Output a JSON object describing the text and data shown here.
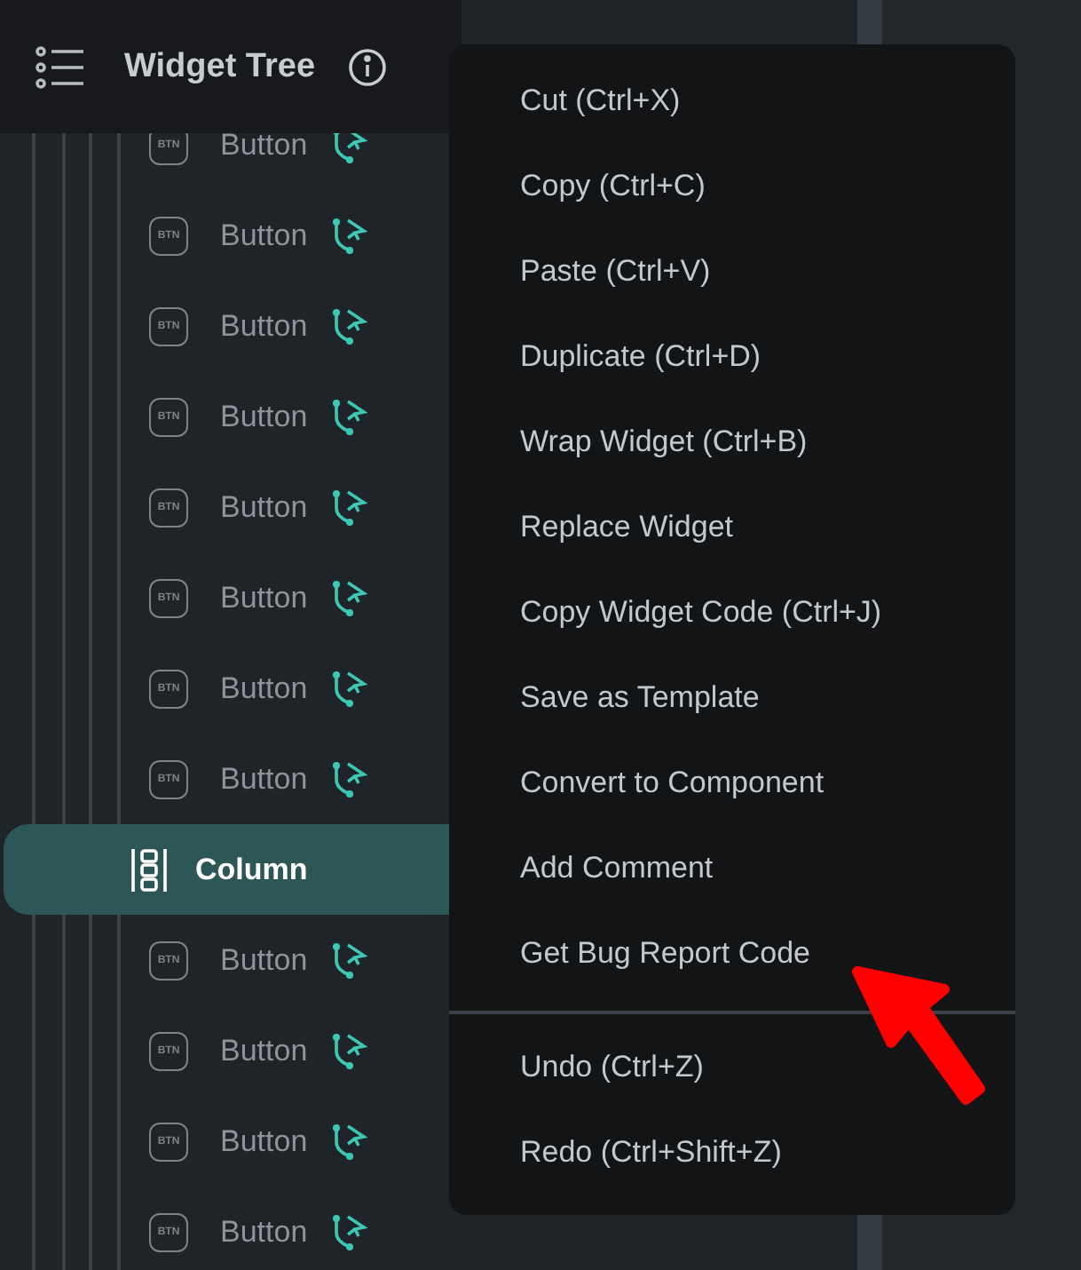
{
  "header": {
    "title": "Widget Tree"
  },
  "tree": {
    "rows": [
      {
        "kind": "button",
        "label": "Button",
        "icon_text": "BTN",
        "selected": false
      },
      {
        "kind": "button",
        "label": "Button",
        "icon_text": "BTN",
        "selected": false
      },
      {
        "kind": "button",
        "label": "Button",
        "icon_text": "BTN",
        "selected": false
      },
      {
        "kind": "button",
        "label": "Button",
        "icon_text": "BTN",
        "selected": false
      },
      {
        "kind": "button",
        "label": "Button",
        "icon_text": "BTN",
        "selected": false
      },
      {
        "kind": "button",
        "label": "Button",
        "icon_text": "BTN",
        "selected": false
      },
      {
        "kind": "button",
        "label": "Button",
        "icon_text": "BTN",
        "selected": false
      },
      {
        "kind": "button",
        "label": "Button",
        "icon_text": "BTN",
        "selected": false
      },
      {
        "kind": "column",
        "label": "Column",
        "selected": true
      },
      {
        "kind": "button",
        "label": "Button",
        "icon_text": "BTN",
        "selected": false
      },
      {
        "kind": "button",
        "label": "Button",
        "icon_text": "BTN",
        "selected": false
      },
      {
        "kind": "button",
        "label": "Button",
        "icon_text": "BTN",
        "selected": false
      },
      {
        "kind": "button",
        "label": "Button",
        "icon_text": "BTN",
        "selected": false
      }
    ]
  },
  "context_menu": {
    "groups": [
      [
        "Cut (Ctrl+X)",
        "Copy (Ctrl+C)",
        "Paste (Ctrl+V)",
        "Duplicate (Ctrl+D)",
        "Wrap Widget (Ctrl+B)",
        "Replace Widget",
        "Copy Widget Code (Ctrl+J)",
        "Save as Template",
        "Convert to Component",
        "Add Comment",
        "Get Bug Report Code"
      ],
      [
        "Undo (Ctrl+Z)",
        "Redo (Ctrl+Shift+Z)"
      ]
    ]
  }
}
